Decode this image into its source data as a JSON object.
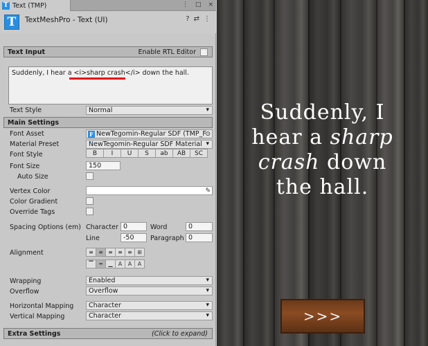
{
  "tab": {
    "title": "Text (TMP)"
  },
  "component": {
    "title": "TextMeshPro - Text (UI)"
  },
  "text_input": {
    "header": "Text Input",
    "rtl_label": "Enable RTL Editor",
    "value": "Suddenly, I hear a <i>sharp crash</i> down the hall.",
    "text_style_label": "Text Style",
    "text_style_value": "Normal"
  },
  "main_settings": {
    "header": "Main Settings",
    "font_asset_label": "Font Asset",
    "font_asset_value": "NewTegomin-Regular SDF (TMP_F",
    "material_preset_label": "Material Preset",
    "material_preset_value": "NewTegomin-Regular SDF Material",
    "font_style_label": "Font Style",
    "font_style_buttons": [
      "B",
      "I",
      "U",
      "S",
      "ab",
      "AB",
      "SC"
    ],
    "font_size_label": "Font Size",
    "font_size_value": "150",
    "auto_size_label": "Auto Size",
    "vertex_color_label": "Vertex Color",
    "color_gradient_label": "Color Gradient",
    "override_tags_label": "Override Tags",
    "spacing_label": "Spacing Options (em)",
    "character_label": "Character",
    "character_value": "0",
    "word_label": "Word",
    "word_value": "0",
    "line_label": "Line",
    "line_value": "-50",
    "paragraph_label": "Paragraph",
    "paragraph_value": "0",
    "alignment_label": "Alignment",
    "wrapping_label": "Wrapping",
    "wrapping_value": "Enabled",
    "overflow_label": "Overflow",
    "overflow_value": "Overflow",
    "horizontal_mapping_label": "Horizontal Mapping",
    "horizontal_mapping_value": "Character",
    "vertical_mapping_label": "Vertical Mapping",
    "vertical_mapping_value": "Character"
  },
  "extra_settings": {
    "header": "Extra Settings",
    "hint": "(Click to expand)"
  },
  "game_view": {
    "line1": "Suddenly, I",
    "line2_a": "hear a ",
    "line2_italic": "sharp",
    "line3_italic": "crash",
    "line3_b": " down",
    "line4": "the hall.",
    "next_button": ">>>"
  },
  "colors": {
    "highlight_underline": "#e51212",
    "tmp_icon": "#2a8ee0",
    "wood_button": "#8a4b22"
  }
}
